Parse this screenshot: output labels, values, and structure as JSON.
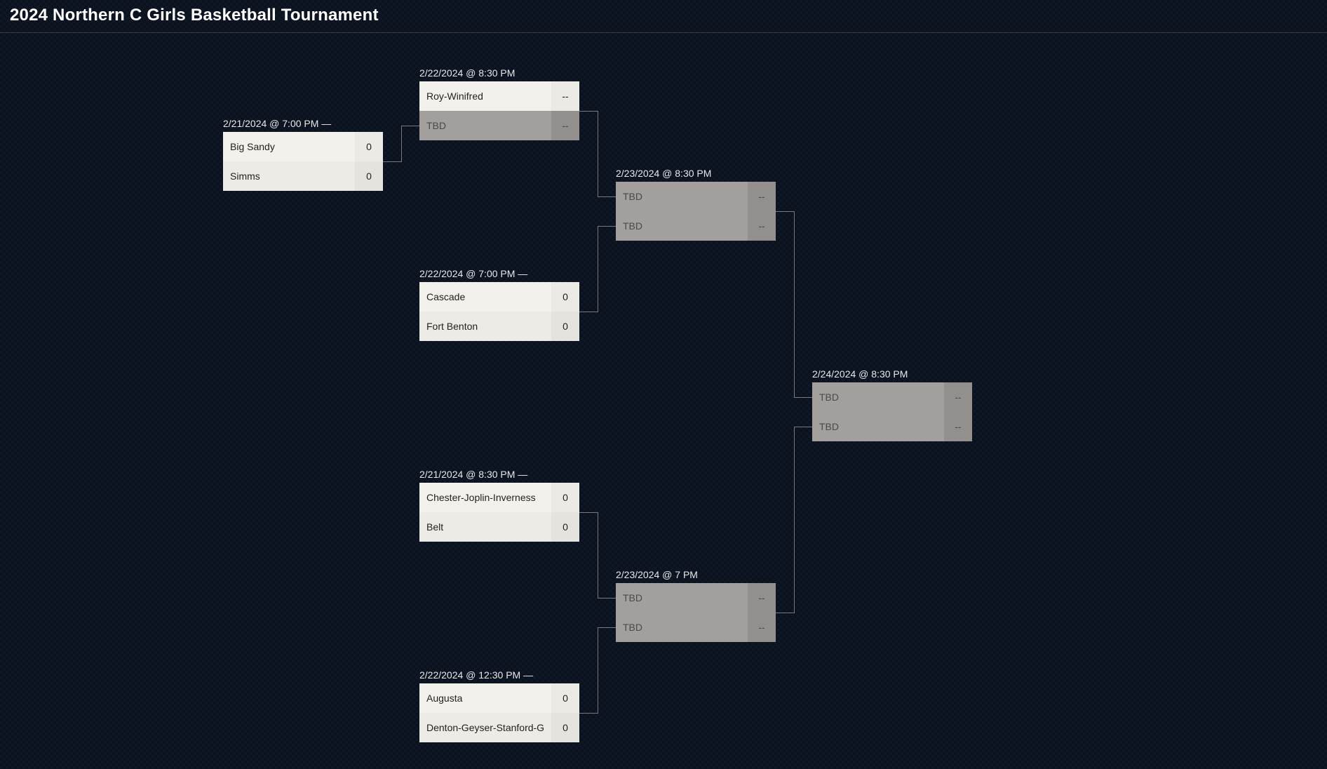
{
  "title": "2024 Northern C Girls Basketball Tournament",
  "matches": {
    "m1": {
      "date": "2/21/2024 @ 7:00 PM —",
      "team1": "Big Sandy",
      "score1": "0",
      "team2": "Simms",
      "score2": "0"
    },
    "m2": {
      "date": "2/22/2024 @ 8:30 PM",
      "team1": "Roy-Winifred",
      "score1": "--",
      "team2": "TBD",
      "score2": "--"
    },
    "m3": {
      "date": "2/22/2024 @ 7:00 PM —",
      "team1": "Cascade",
      "score1": "0",
      "team2": "Fort Benton",
      "score2": "0"
    },
    "m4": {
      "date": "2/23/2024 @ 8:30 PM",
      "team1": "TBD",
      "score1": "--",
      "team2": "TBD",
      "score2": "--"
    },
    "m5": {
      "date": "2/21/2024 @ 8:30 PM —",
      "team1": "Chester-Joplin-Inverness",
      "score1": "0",
      "team2": "Belt",
      "score2": "0"
    },
    "m6": {
      "date": "2/22/2024 @ 12:30 PM —",
      "team1": "Augusta",
      "score1": "0",
      "team2": "Denton-Geyser-Stanford-G",
      "score2": "0"
    },
    "m7": {
      "date": "2/23/2024 @ 7 PM",
      "team1": "TBD",
      "score1": "--",
      "team2": "TBD",
      "score2": "--"
    },
    "m8": {
      "date": "2/24/2024 @ 8:30 PM",
      "team1": "TBD",
      "score1": "--",
      "team2": "TBD",
      "score2": "--"
    }
  }
}
